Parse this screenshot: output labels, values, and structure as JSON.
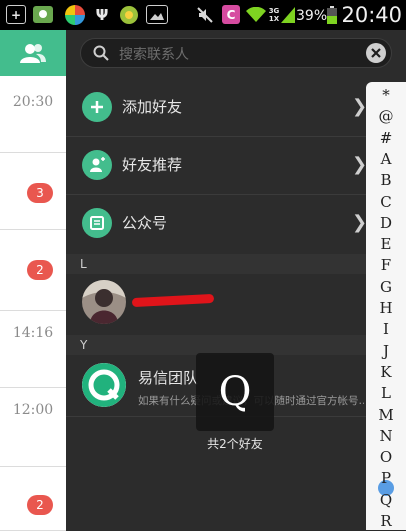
{
  "status_bar": {
    "battery": "39%",
    "time": "20:40",
    "icons": [
      "add-icon",
      "contacts-app-icon",
      "pinwheel-icon",
      "usb-icon",
      "coin-icon",
      "gallery-icon",
      "mute-icon",
      "c-app-icon",
      "wifi-icon",
      "signal-icon",
      "battery-icon"
    ],
    "network_labels": [
      "3G",
      "1X"
    ]
  },
  "left_panel": {
    "times": [
      "20:30",
      "14:16",
      "12:00"
    ],
    "badges": [
      "3",
      "2",
      "2"
    ]
  },
  "search": {
    "placeholder": "搜索联系人"
  },
  "menu": [
    {
      "label": "添加好友",
      "icon": "add-friend-icon"
    },
    {
      "label": "好友推荐",
      "icon": "recommend-friend-icon"
    },
    {
      "label": "公众号",
      "icon": "official-account-icon"
    }
  ],
  "sections": [
    {
      "letter": "L"
    },
    {
      "letter": "Y"
    }
  ],
  "contacts": [
    {
      "name": "",
      "desc": ""
    },
    {
      "name": "易信团队",
      "desc": "如果有什么疑问或建议，可以随时通过官方帐号…"
    }
  ],
  "overlay": {
    "letter": "Q",
    "count": "共2个好友"
  },
  "index_letters": [
    "*",
    "@",
    "#",
    "A",
    "B",
    "C",
    "D",
    "E",
    "F",
    "G",
    "H",
    "I",
    "J",
    "K",
    "L",
    "M",
    "N",
    "O",
    "P",
    "Q",
    "R"
  ],
  "colors": {
    "accent": "#43bd8d",
    "badge": "#e9574f",
    "drawer_bg": "#2c2c2c"
  }
}
